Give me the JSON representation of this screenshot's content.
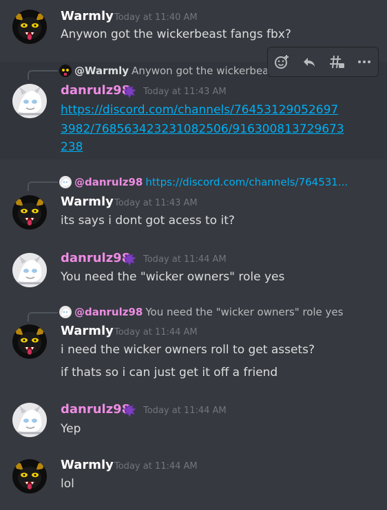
{
  "users": {
    "warmly": {
      "name": "Warmly"
    },
    "danrulz": {
      "name": "danrulz98"
    }
  },
  "messages": [
    {
      "author": "Warmly",
      "timestamp": "Today at 11:40 AM",
      "text": "Anywon got the wickerbeast fangs fbx?"
    },
    {
      "author": "danrulz98",
      "timestamp": "Today at 11:43 AM",
      "reply": {
        "name": "@Warmly",
        "text": "Anywon got the wickerbeast fangs"
      },
      "link_lines": [
        "https://discord.com/channels/76453129052697",
        "3982/768563423231082506/916300813729673",
        "238"
      ]
    },
    {
      "author": "Warmly",
      "timestamp": "Today at 11:43 AM",
      "reply": {
        "name": "@danrulz98",
        "text": "https://discord.com/channels/764531..."
      },
      "text": "its says i dont got acess to it?"
    },
    {
      "author": "danrulz98",
      "timestamp": "Today at 11:44 AM",
      "text": "You need the \"wicker owners\" role yes"
    },
    {
      "author": "Warmly",
      "timestamp": "Today at 11:44 AM",
      "reply": {
        "name": "@danrulz98",
        "text": "You need the \"wicker owners\" role yes"
      },
      "text": "i need the wicker owners roll to get assets?",
      "text2": "if thats so i can just get it off a friend"
    },
    {
      "author": "danrulz98",
      "timestamp": "Today at 11:44 AM",
      "text": "Yep"
    },
    {
      "author": "Warmly",
      "timestamp": "Today at 11:44 AM",
      "text": "lol"
    }
  ],
  "toolbar": {
    "icons": [
      "add-reaction-icon",
      "reply-icon",
      "create-thread-icon",
      "more-icon"
    ]
  },
  "colors": {
    "background": "#36393f",
    "hover": "#32353b",
    "dan_name": "#ee8ce4",
    "link": "#00aff4",
    "timestamp": "#72767d"
  }
}
